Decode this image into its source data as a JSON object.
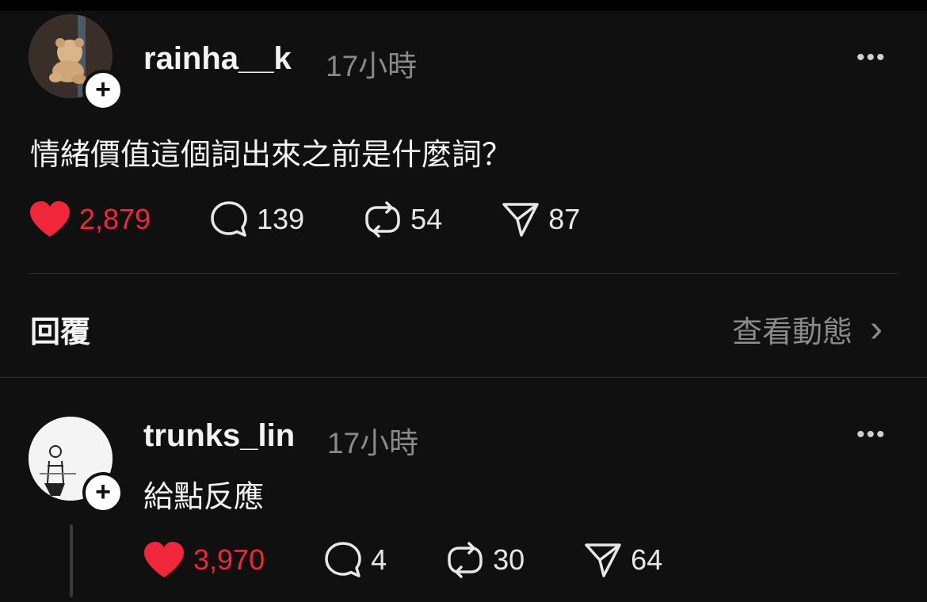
{
  "post": {
    "username": "rainha__k",
    "time": "17小時",
    "more": "•••",
    "text": "情緒價值這個詞出來之前是什麼詞？",
    "likes": "2,879",
    "comments": "139",
    "reposts": "54",
    "shares": "87"
  },
  "replies_header": {
    "label": "回覆",
    "view_activity": "查看動態",
    "chevron": "›"
  },
  "reply": {
    "username": "trunks_lin",
    "time": "17小時",
    "more": "•••",
    "text": "給點反應",
    "likes": "3,970",
    "comments": "4",
    "reposts": "30",
    "shares": "64"
  },
  "icons": {
    "follow": "+",
    "like_color": "#f0273a"
  }
}
